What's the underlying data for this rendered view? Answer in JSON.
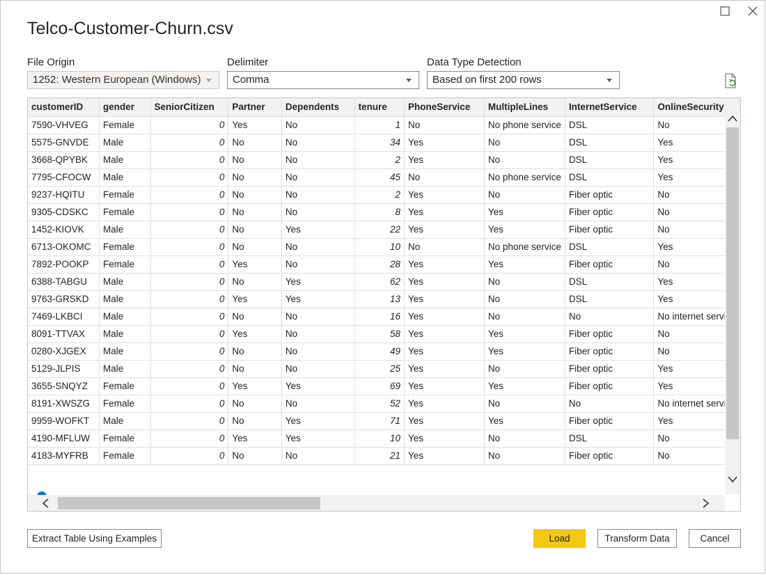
{
  "dialog": {
    "title": "Telco-Customer-Churn.csv"
  },
  "options": {
    "file_origin": {
      "label": "File Origin",
      "value": "1252: Western European (Windows)"
    },
    "delimiter": {
      "label": "Delimiter",
      "value": "Comma"
    },
    "detection": {
      "label": "Data Type Detection",
      "value": "Based on first 200 rows"
    }
  },
  "table": {
    "columns": [
      "customerID",
      "gender",
      "SeniorCitizen",
      "Partner",
      "Dependents",
      "tenure",
      "PhoneService",
      "MultipleLines",
      "InternetService",
      "OnlineSecurity"
    ],
    "rows": [
      [
        "7590-VHVEG",
        "Female",
        "0",
        "Yes",
        "No",
        "1",
        "No",
        "No phone service",
        "DSL",
        "No"
      ],
      [
        "5575-GNVDE",
        "Male",
        "0",
        "No",
        "No",
        "34",
        "Yes",
        "No",
        "DSL",
        "Yes"
      ],
      [
        "3668-QPYBK",
        "Male",
        "0",
        "No",
        "No",
        "2",
        "Yes",
        "No",
        "DSL",
        "Yes"
      ],
      [
        "7795-CFOCW",
        "Male",
        "0",
        "No",
        "No",
        "45",
        "No",
        "No phone service",
        "DSL",
        "Yes"
      ],
      [
        "9237-HQITU",
        "Female",
        "0",
        "No",
        "No",
        "2",
        "Yes",
        "No",
        "Fiber optic",
        "No"
      ],
      [
        "9305-CDSKC",
        "Female",
        "0",
        "No",
        "No",
        "8",
        "Yes",
        "Yes",
        "Fiber optic",
        "No"
      ],
      [
        "1452-KIOVK",
        "Male",
        "0",
        "No",
        "Yes",
        "22",
        "Yes",
        "Yes",
        "Fiber optic",
        "No"
      ],
      [
        "6713-OKOMC",
        "Female",
        "0",
        "No",
        "No",
        "10",
        "No",
        "No phone service",
        "DSL",
        "Yes"
      ],
      [
        "7892-POOKP",
        "Female",
        "0",
        "Yes",
        "No",
        "28",
        "Yes",
        "Yes",
        "Fiber optic",
        "No"
      ],
      [
        "6388-TABGU",
        "Male",
        "0",
        "No",
        "Yes",
        "62",
        "Yes",
        "No",
        "DSL",
        "Yes"
      ],
      [
        "9763-GRSKD",
        "Male",
        "0",
        "Yes",
        "Yes",
        "13",
        "Yes",
        "No",
        "DSL",
        "Yes"
      ],
      [
        "7469-LKBCI",
        "Male",
        "0",
        "No",
        "No",
        "16",
        "Yes",
        "No",
        "No",
        "No internet service"
      ],
      [
        "8091-TTVAX",
        "Male",
        "0",
        "Yes",
        "No",
        "58",
        "Yes",
        "Yes",
        "Fiber optic",
        "No"
      ],
      [
        "0280-XJGEX",
        "Male",
        "0",
        "No",
        "No",
        "49",
        "Yes",
        "Yes",
        "Fiber optic",
        "No"
      ],
      [
        "5129-JLPIS",
        "Male",
        "0",
        "No",
        "No",
        "25",
        "Yes",
        "No",
        "Fiber optic",
        "Yes"
      ],
      [
        "3655-SNQYZ",
        "Female",
        "0",
        "Yes",
        "Yes",
        "69",
        "Yes",
        "Yes",
        "Fiber optic",
        "Yes"
      ],
      [
        "8191-XWSZG",
        "Female",
        "0",
        "No",
        "No",
        "52",
        "Yes",
        "No",
        "No",
        "No internet service"
      ],
      [
        "9959-WOFKT",
        "Male",
        "0",
        "No",
        "Yes",
        "71",
        "Yes",
        "Yes",
        "Fiber optic",
        "Yes"
      ],
      [
        "4190-MFLUW",
        "Female",
        "0",
        "Yes",
        "Yes",
        "10",
        "Yes",
        "No",
        "DSL",
        "No"
      ],
      [
        "4183-MYFRB",
        "Female",
        "0",
        "No",
        "No",
        "21",
        "Yes",
        "No",
        "Fiber optic",
        "No"
      ]
    ],
    "numeric_columns": [
      2,
      5
    ]
  },
  "buttons": {
    "extract": "Extract Table Using Examples",
    "load": "Load",
    "transform": "Transform Data",
    "cancel": "Cancel"
  },
  "colors": {
    "primary_button": "#f2c811",
    "border": "#8a8886",
    "header_bg": "#f3f2f1",
    "scrollbar_thumb": "#c8c6c4",
    "info_icon": "#0078d4",
    "refresh_icon_accent": "#107c10"
  },
  "icons": {
    "window": [
      "maximize-icon",
      "close-icon"
    ],
    "refresh": "refresh-file-icon",
    "scroll": [
      "chevron-up-icon",
      "chevron-down-icon",
      "chevron-left-icon",
      "chevron-right-icon"
    ],
    "info": "info-icon"
  }
}
